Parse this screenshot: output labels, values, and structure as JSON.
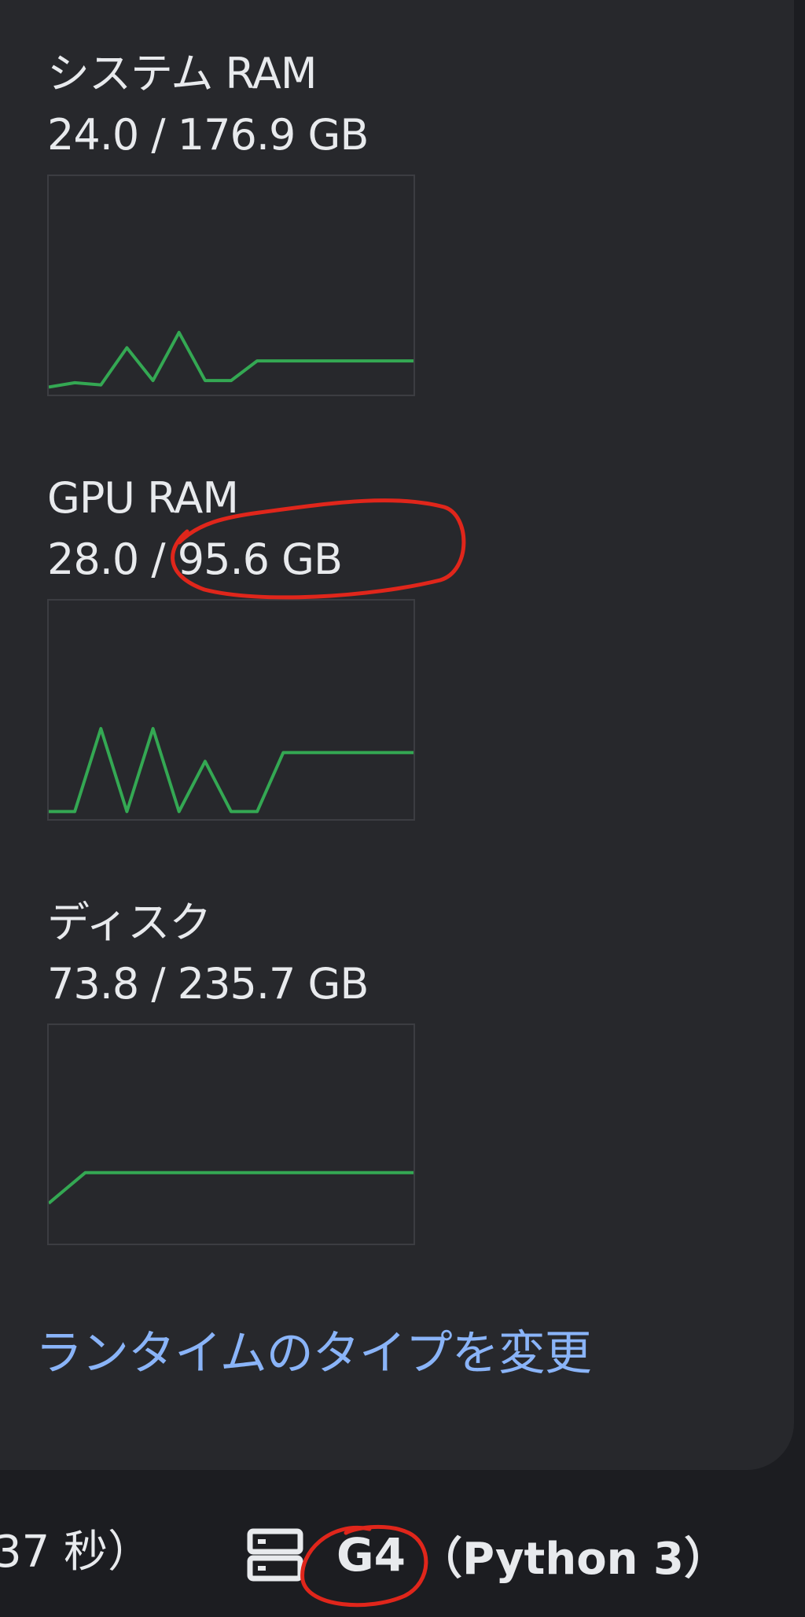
{
  "resources": [
    {
      "title": "システム RAM",
      "value": "24.0 / 176.9 GB",
      "usage_series": [
        0.02,
        0.04,
        0.03,
        0.2,
        0.05,
        0.27,
        0.05,
        0.05,
        0.14,
        0.14,
        0.14,
        0.14,
        0.14,
        0.14,
        0.14
      ],
      "line_color": "#34a853"
    },
    {
      "title": "GPU RAM",
      "value": "28.0 / 95.6 GB",
      "usage_series": [
        0.02,
        0.02,
        0.4,
        0.02,
        0.4,
        0.02,
        0.25,
        0.02,
        0.02,
        0.29,
        0.29,
        0.29,
        0.29,
        0.29,
        0.29
      ],
      "line_color": "#34a853"
    },
    {
      "title": "ディスク",
      "value": "73.8 / 235.7 GB",
      "usage_series": [
        0.17,
        0.31,
        0.31,
        0.31,
        0.31,
        0.31,
        0.31,
        0.31,
        0.31,
        0.31,
        0.31
      ],
      "line_color": "#34a853"
    }
  ],
  "change_runtime_link": "ランタイムのタイプを変更",
  "status_bar": {
    "elapsed_text": "37 秒）",
    "gpu": "G4",
    "runtime": "（Python 3）"
  },
  "colors": {
    "panel_bg": "#27282c",
    "link": "#8ab4f8",
    "annotation": "#e0261b"
  }
}
